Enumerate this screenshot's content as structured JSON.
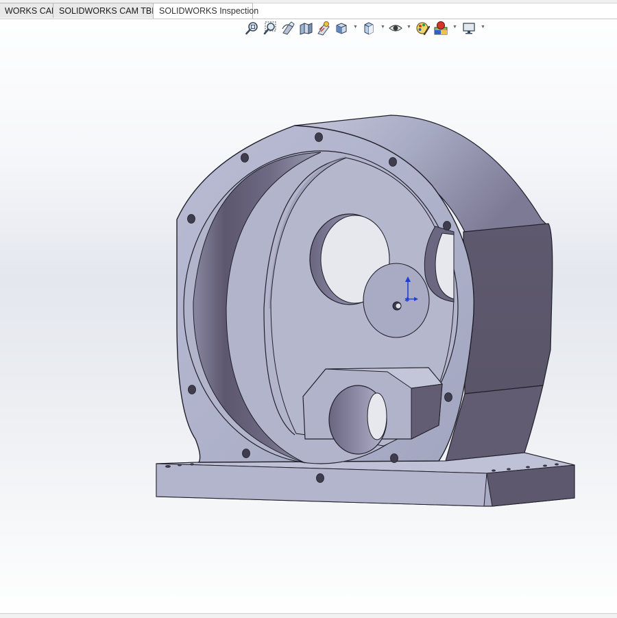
{
  "tabs": [
    {
      "label": "WORKS CAM",
      "active": false
    },
    {
      "label": "SOLIDWORKS CAM TBM",
      "active": false
    },
    {
      "label": "SOLIDWORKS Inspection",
      "active": true
    }
  ],
  "toolbar": {
    "icons": [
      "zoom-to-fit-icon",
      "zoom-to-area-icon",
      "previous-view-icon",
      "section-view-icon",
      "dynamic-annotation-icon",
      "view-orientation-icon",
      "display-style-icon",
      "hide-show-items-icon",
      "edit-appearance-icon",
      "apply-scene-icon",
      "view-settings-icon"
    ]
  },
  "colors": {
    "part_light": "#b4b7cf",
    "part_mid": "#9ea1bb",
    "part_dark": "#5f5a70",
    "edge": "#1f1f2a",
    "background_top": "#ffffff",
    "background_mid": "#e4e7ee"
  }
}
